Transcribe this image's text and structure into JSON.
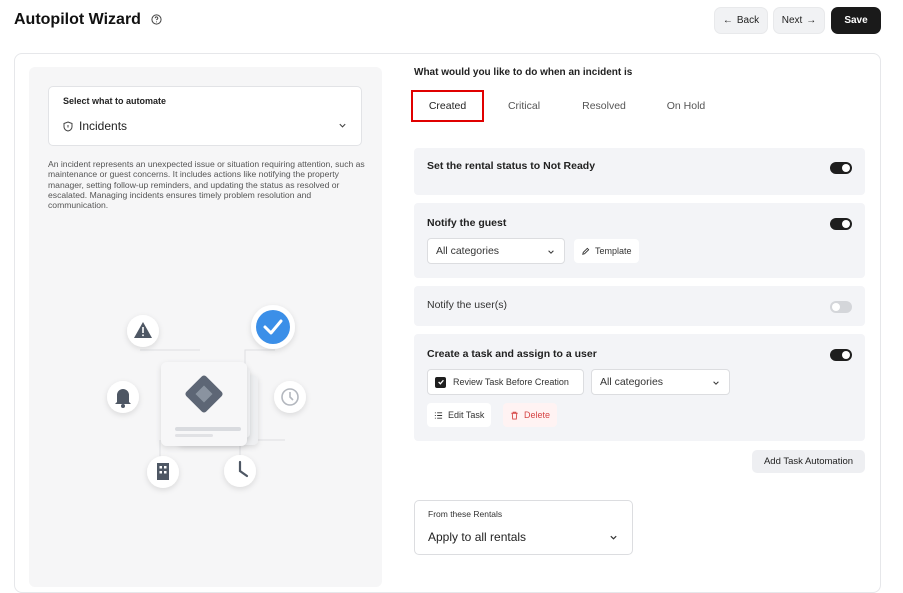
{
  "header": {
    "title": "Autopilot Wizard",
    "back_label": "Back",
    "next_label": "Next",
    "save_label": "Save"
  },
  "left_panel": {
    "select_label": "Select what to automate",
    "select_value": "Incidents",
    "description": "An incident represents an unexpected issue or situation requiring attention, such as maintenance or guest concerns. It includes actions like notifying the property manager, setting follow-up reminders, and updating the status as resolved or escalated. Managing incidents ensures timely problem resolution and communication."
  },
  "main": {
    "question": "What would you like to do when an incident is",
    "tabs": [
      {
        "label": "Created",
        "active": true
      },
      {
        "label": "Critical",
        "active": false
      },
      {
        "label": "Resolved",
        "active": false
      },
      {
        "label": "On Hold",
        "active": false
      }
    ],
    "rows": {
      "rental_status": {
        "title": "Set the rental status to Not Ready",
        "enabled": true
      },
      "notify_guest": {
        "title": "Notify the guest",
        "enabled": true,
        "category": "All categories",
        "template_label": "Template"
      },
      "notify_users": {
        "title": "Notify the user(s)",
        "enabled": false
      },
      "create_task": {
        "title": "Create a task and assign to a user",
        "enabled": true,
        "review_label": "Review Task Before Creation",
        "review_checked": true,
        "category": "All categories",
        "edit_label": "Edit Task",
        "delete_label": "Delete"
      }
    },
    "add_task_label": "Add Task Automation",
    "rentals": {
      "label": "From these Rentals",
      "value": "Apply to all rentals"
    }
  },
  "colors": {
    "accent_dark": "#1a1a1a",
    "highlight_red": "#e00000",
    "check_blue": "#3b8fe8",
    "delete_red": "#d64545"
  }
}
